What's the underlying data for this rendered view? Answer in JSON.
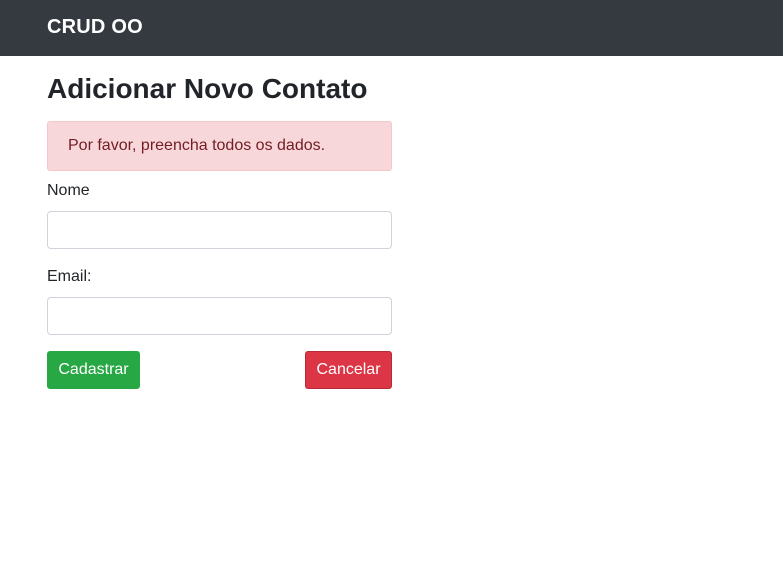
{
  "navbar": {
    "brand": "CRUD OO",
    "background_color": "#343a40"
  },
  "main": {
    "title": "Adicionar Novo Contato",
    "alert": {
      "message": "Por favor, preencha todos os dados.",
      "background_color": "#f8d7da",
      "text_color": "#721c24"
    },
    "form": {
      "name_label": "Nome",
      "name_value": "",
      "email_label": "Email:",
      "email_value": "",
      "submit_label": "Cadastrar",
      "submit_color": "#28a745",
      "cancel_label": "Cancelar",
      "cancel_color": "#dc3545"
    }
  }
}
